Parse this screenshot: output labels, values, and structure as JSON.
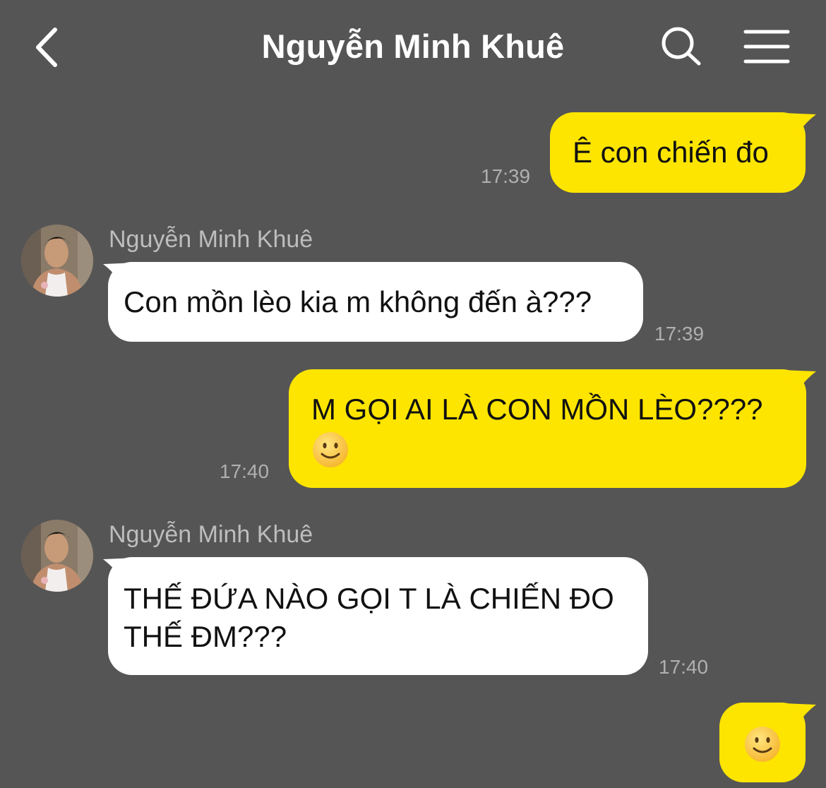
{
  "header": {
    "title": "Nguyễn Minh Khuê"
  },
  "messages": [
    {
      "from": "me",
      "text": "Ê con chiến đo",
      "time": "17:39"
    },
    {
      "from": "them",
      "sender": "Nguyễn Minh Khuê",
      "text": "Con mồn lèo kia m không đến à???",
      "time": "17:39"
    },
    {
      "from": "me",
      "line1": "M GỌI AI LÀ CON MỒN LÈO????",
      "emoji": "slightly-smiling-face",
      "time": "17:40"
    },
    {
      "from": "them",
      "sender": "Nguyễn Minh Khuê",
      "line1": "THẾ ĐỨA NÀO GỌI T LÀ CHIẾN ĐO",
      "line2": "THẾ ĐM???",
      "time": "17:40"
    },
    {
      "from": "me",
      "emoji": "slightly-smiling-face"
    }
  ],
  "colors": {
    "background": "#555555",
    "my_bubble": "#FEE500",
    "their_bubble": "#FFFFFF",
    "timestamp": "#B0B0B0"
  }
}
